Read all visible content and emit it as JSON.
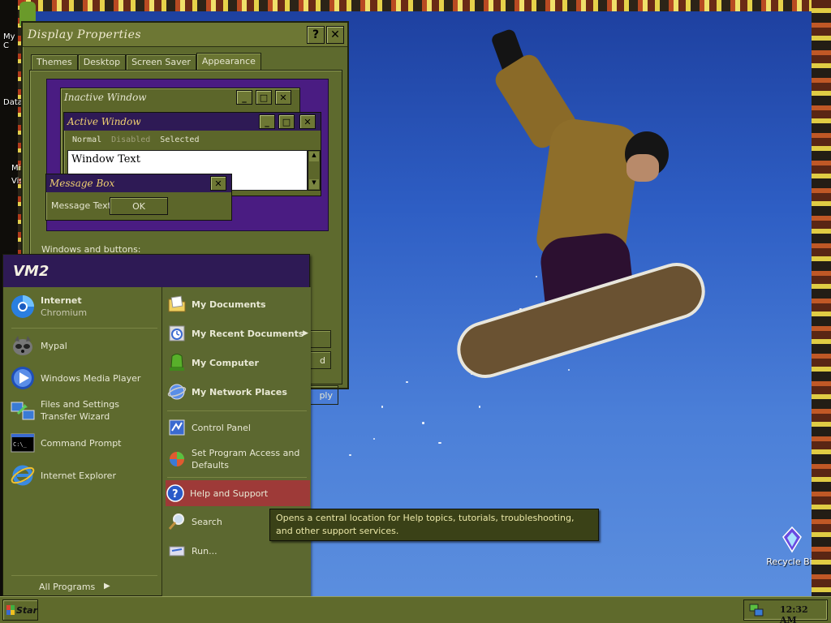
{
  "desktop": {
    "left_icons": [
      {
        "label": "My C"
      },
      {
        "label": "Data"
      },
      {
        "label": "Mi"
      },
      {
        "label": "Vis"
      }
    ],
    "recycle_bin": {
      "label": "Recycle Bin",
      "icon": "recycle-bin-icon"
    }
  },
  "display_properties": {
    "title": "Display Properties",
    "help_label": "?",
    "close_label": "✕",
    "tabs": [
      {
        "label": "Themes"
      },
      {
        "label": "Desktop"
      },
      {
        "label": "Screen Saver"
      },
      {
        "label": "Appearance",
        "active": true
      }
    ],
    "preview": {
      "inactive_title": "Inactive Window",
      "active_title": "Active Window",
      "menu_items": [
        "Normal",
        "Disabled",
        "Selected"
      ],
      "window_text": "Window Text",
      "message_title": "Message Box",
      "message_text": "Message Text",
      "ok_label": "OK"
    },
    "windows_buttons_label": "Windows and buttons:",
    "button_fragments": [
      "d",
      "ply"
    ]
  },
  "start_menu": {
    "user": "VM2",
    "pinned": [
      {
        "title": "Internet",
        "subtitle": "Chromium",
        "icon": "chromium-icon"
      }
    ],
    "recent": [
      {
        "title": "Mypal",
        "icon": "mypal-raccoon-icon"
      },
      {
        "title": "Windows Media Player",
        "icon": "media-player-icon"
      },
      {
        "title": "Files and Settings Transfer Wizard",
        "icon": "transfer-wizard-icon"
      },
      {
        "title": "Command Prompt",
        "icon": "command-prompt-icon"
      },
      {
        "title": "Internet Explorer",
        "icon": "internet-explorer-icon"
      }
    ],
    "all_programs": "All Programs",
    "places": [
      {
        "label": "My Documents",
        "icon": "my-documents-icon"
      },
      {
        "label": "My Recent Documents",
        "icon": "recent-documents-icon"
      },
      {
        "label": "My Computer",
        "icon": "my-computer-icon"
      },
      {
        "label": "My Network Places",
        "icon": "network-places-icon"
      }
    ],
    "system": [
      {
        "label": "Control Panel",
        "icon": "control-panel-icon"
      },
      {
        "label": "Set Program Access and Defaults",
        "icon": "program-access-icon"
      }
    ],
    "help": [
      {
        "label": "Help and Support",
        "icon": "help-icon",
        "highlighted": true
      },
      {
        "label": "Search",
        "icon": "search-icon"
      },
      {
        "label": "Run...",
        "icon": "run-icon"
      }
    ],
    "tooltip": "Opens a central location for Help topics, tutorials, troubleshooting, and other support services."
  },
  "taskbar": {
    "start_label": "Star",
    "clock": "12:32 AM"
  },
  "colors": {
    "theme_olive": "#5e6a2e",
    "start_header": "#2e1a55",
    "highlight": "#9e3a38",
    "preview_bg": "#4a1c82"
  }
}
